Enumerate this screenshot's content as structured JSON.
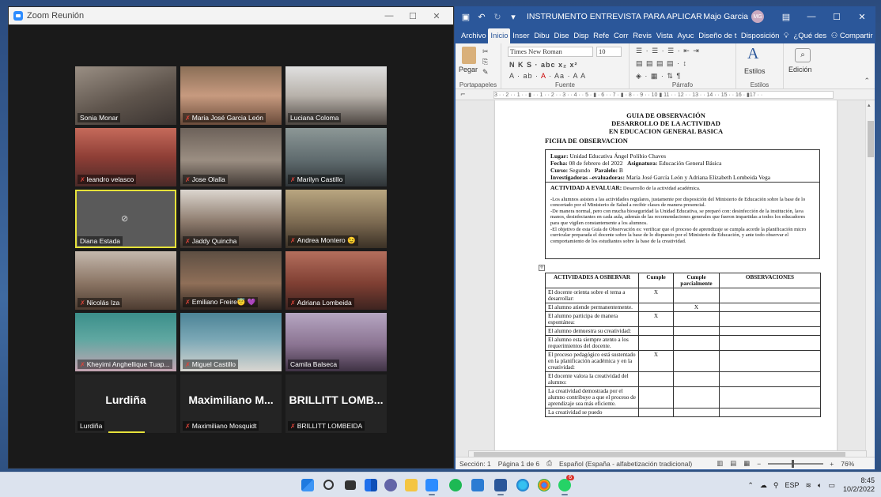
{
  "zoom": {
    "title": "Zoom Reunión",
    "participants": [
      {
        "name": "Sonia Monar",
        "muted": false
      },
      {
        "name": "Maria José Garcia León",
        "muted": true
      },
      {
        "name": "Luciana Coloma",
        "muted": false
      },
      {
        "name": "leandro velasco",
        "muted": true
      },
      {
        "name": "Jose Olalla",
        "muted": true
      },
      {
        "name": "Marilyn Castillo",
        "muted": true
      },
      {
        "name": "Diana Estada",
        "muted": false,
        "camera_off": true,
        "active_speaker": true
      },
      {
        "name": "Jaddy Quincha",
        "muted": true
      },
      {
        "name": "Andrea Montero 😉",
        "muted": true
      },
      {
        "name": "Nicolás Iza",
        "muted": true
      },
      {
        "name": "Emiliano Freire😇 💜",
        "muted": true
      },
      {
        "name": "Adriana Lombeida",
        "muted": true
      },
      {
        "name": "Kheyimi Anghellique Tuap...",
        "muted": true
      },
      {
        "name": "Miguel Castillo",
        "muted": true
      },
      {
        "name": "Camila Balseca",
        "muted": false
      },
      {
        "name": "Lurdiña",
        "big_name": "Lurdiña",
        "muted": false
      },
      {
        "name": "Maximiliano Mosquidt",
        "big_name": "Maximiliano M...",
        "muted": true
      },
      {
        "name": "BRILLITT LOMBEIDA",
        "big_name": "BRILLITT LOMB...",
        "muted": true
      }
    ]
  },
  "word": {
    "doc_title": "INSTRUMENTO ENTREVISTA PARA APLICAR AL G...",
    "user_name": "Majo Garcia",
    "user_initials": "MG",
    "tabs": [
      "Archivo",
      "Inicio",
      "Inser",
      "Dibu",
      "Dise",
      "Disp",
      "Refe",
      "Corr",
      "Revis",
      "Vista",
      "Ayuc",
      "Diseño de t",
      "Disposición"
    ],
    "tell_me": "¿Qué des",
    "share": "Compartir",
    "ribbon": {
      "paste": "Pegar",
      "clipboard": "Portapapeles",
      "font_name": "Times New Roman",
      "font_size": "10",
      "font_group": "Fuente",
      "paragraph_group": "Párrafo",
      "styles": "Estilos",
      "styles_group": "Estilos",
      "editing": "Edición"
    },
    "ruler_text": "3 · · 2 · · 1 · · ▮ · · 1 · · 2 · · 3 · · 4 · · 5 · ▮ · 6 · · 7 · ▮ · 8 · · 9 · · 10 ▮ 11 · · 12 · · 13 · · 14 · · 15 · · 16 · ▮17 · ·",
    "document": {
      "header1": "GUIA DE OBSERVACIÓN",
      "header2": "DESARROLLO DE LA ACTIVIDAD",
      "header3": "EN EDUCACION GENERAL BASICA",
      "ficha": "FICHA DE OBSERVACION",
      "lugar_label": "Lugar:",
      "lugar": "Unidad Educativa Ángel Polibio Chaves",
      "fecha_label": "Fecha:",
      "fecha": "08 de febrero del 2022",
      "asignatura_label": "Asignatura:",
      "asignatura": "Educación General Básica",
      "curso_label": "Curso:",
      "curso": "Segundo",
      "paralelo_label": "Paralelo:",
      "paralelo": "B",
      "investigadoras_label": "Investigadoras –evaluadoras:",
      "investigadoras": "María José García León y Adriana Elizabeth Lombeida Vega",
      "actividad_label": "ACTIVIDAD A EVALUAR:",
      "actividad": "Desarrollo de la actividad académica.",
      "para1": "-Los alumnos asisten a las actividades regulares, justamente por disposición del Ministerio de Educación sobre la base de lo concertado por el Ministerio de Salud a recibir clases de manera presencial.",
      "para2": "-De manera normal, pero con mucha bioseguridad la Unidad Educativa, se preparó con: desinfección de la institución, lava manos, desinfectantes en cada aula, además de las recomendaciones generales que fueron impartidas a todos los educadores para que vigilen constantemente a los alumnos.",
      "para3": "-El objetivo de esta Guía de Observación es: verificar que el proceso de aprendizaje se cumpla acorde la planificación micro curricular preparada el docente sobre la base de lo dispuesto por el Ministerio de Educación, y ante todo observar el comportamiento de los estudiantes sobre la base de la creatividad.",
      "table_headers": [
        "ACTIVIDADES A OSBERVAR",
        "Cumple",
        "Cumple parcialmente",
        "OBSERVACIONES"
      ],
      "table_rows": [
        {
          "activity": "El docente orienta sobre el tema a desarrollar:",
          "cumple": "X",
          "parcial": "",
          "obs": ""
        },
        {
          "activity": "El alumno atiende permanentemente.",
          "cumple": "",
          "parcial": "X",
          "obs": ""
        },
        {
          "activity": "El alumno participa de manera espontánea:",
          "cumple": "X",
          "parcial": "",
          "obs": ""
        },
        {
          "activity": "El alumno demuestra su creatividad:",
          "cumple": "",
          "parcial": "",
          "obs": ""
        },
        {
          "activity": "El alumno esta siempre atento a los requerimientos del docente.",
          "cumple": "",
          "parcial": "",
          "obs": ""
        },
        {
          "activity": "El proceso pedagógico está sustentado en la planificación académica y en la creatividad:",
          "cumple": "X",
          "parcial": "",
          "obs": ""
        },
        {
          "activity": "El docente valora la creatividad del alumno:",
          "cumple": "",
          "parcial": "",
          "obs": ""
        },
        {
          "activity": "La creatividad demostrada por el alumno contribuye a que el proceso de aprendizaje sea más eficiente.",
          "cumple": "",
          "parcial": "",
          "obs": ""
        },
        {
          "activity": "La creatividad se puedo",
          "cumple": "",
          "parcial": "",
          "obs": ""
        }
      ]
    },
    "status": {
      "section": "Sección: 1",
      "page": "Página 1 de 6",
      "language": "Español (España - alfabetización tradicional)",
      "zoom": "76%"
    }
  },
  "taskbar": {
    "language": "ESP",
    "time": "8:45",
    "date": "10/2/2022",
    "whatsapp_badge": "6"
  },
  "colors": {
    "word_blue": "#2b579a",
    "zoom_blue": "#2d8cff",
    "active_speaker": "#e6e23a",
    "muted_red": "#e0443a"
  }
}
